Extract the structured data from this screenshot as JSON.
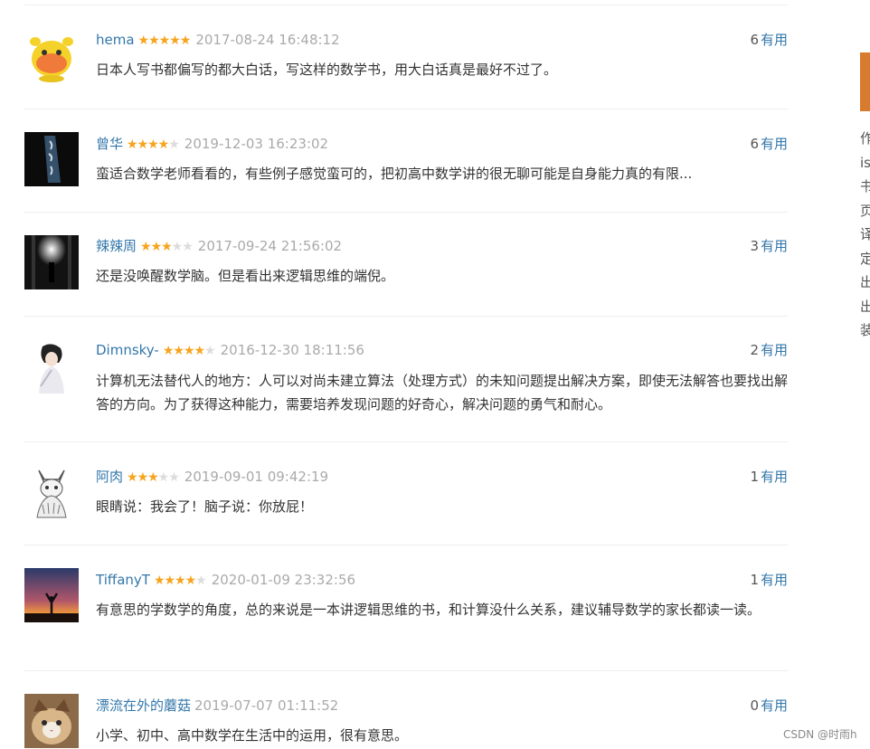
{
  "comments": [
    {
      "user": "hema",
      "rating": 5,
      "time": "2017-08-24 16:48:12",
      "votes": "6",
      "useful_label": "有用",
      "text": "日本人写书都偏写的都大白话，写这样的数学书，用大白话真是最好不过了。",
      "avatar": "yellow-cow-avatar"
    },
    {
      "user": "曾华",
      "rating": 4,
      "time": "2019-12-03 16:23:02",
      "votes": "6",
      "useful_label": "有用",
      "text": "蛮适合数学老师看看的，有些例子感觉蛮可的，把初高中数学讲的很无聊可能是自身能力真的有限...",
      "avatar": "dark-calligraphy-avatar"
    },
    {
      "user": "辣辣周",
      "rating": 3,
      "time": "2017-09-24 21:56:02",
      "votes": "3",
      "useful_label": "有用",
      "text": "还是没唤醒数学脑。但是看出来逻辑思维的端倪。",
      "avatar": "light-corridor-avatar"
    },
    {
      "user": "Dimnsky-",
      "rating": 4,
      "time": "2016-12-30 18:11:56",
      "votes": "2",
      "useful_label": "有用",
      "text": "计算机无法替代人的地方：人可以对尚未建立算法（处理方式）的未知问题提出解决方案，即使无法解答也要找出解答的方向。为了获得这种能力，需要培养发现问题的好奇心，解决问题的勇气和耐心。",
      "avatar": "anime-figure-avatar"
    },
    {
      "user": "阿肉",
      "rating": 3,
      "time": "2019-09-01 09:42:19",
      "votes": "1",
      "useful_label": "有用",
      "text": "眼睛说：我会了！脑子说：你放屁！",
      "avatar": "sketch-cat-avatar"
    },
    {
      "user": "TiffanyT",
      "rating": 4,
      "time": "2020-01-09 23:32:56",
      "votes": "1",
      "useful_label": "有用",
      "text": "有意思的学数学的角度，总的来说是一本讲逻辑思维的书，和计算没什么关系，建议辅导数学的家长都读一读。",
      "avatar": "sunset-silhouette-avatar"
    },
    {
      "user": "漂流在外的蘑菇",
      "rating": 0,
      "time": "2019-07-07 01:11:52",
      "votes": "0",
      "useful_label": "有用",
      "text": "小学、初中、高中数学在生活中的运用，很有意思。",
      "avatar": "cat-photo-avatar"
    }
  ],
  "side_panel": {
    "chars": [
      "作",
      "is",
      "书",
      "页",
      "译",
      "定",
      "出",
      "出",
      "装"
    ]
  },
  "watermark": "CSDN @时雨h",
  "colors": {
    "name_link": "#3377aa",
    "star_on": "#f7a31c",
    "star_off": "#dcdcdc",
    "timestamp": "#aaaaaa",
    "side_accent": "#d77b2e"
  }
}
